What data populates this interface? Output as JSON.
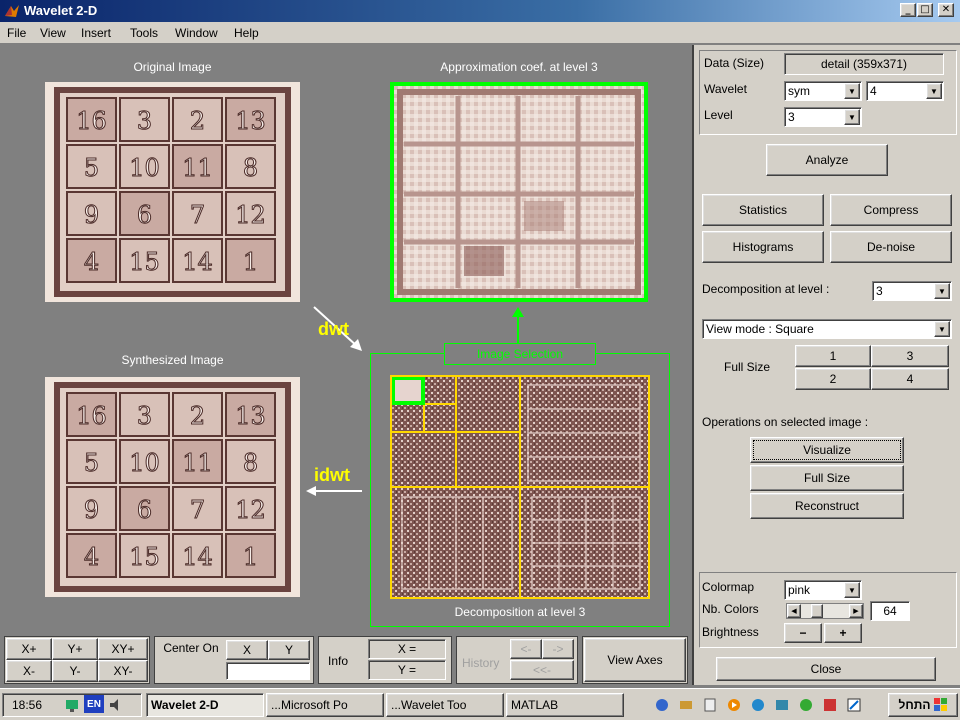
{
  "window": {
    "title": "Wavelet 2-D",
    "min": "_",
    "max": "□",
    "close": "✕"
  },
  "menu": [
    "File",
    "View",
    "Insert",
    "Tools",
    "Window",
    "Help"
  ],
  "images": {
    "original_title": "Original Image",
    "approx_title": "Approximation coef. at level 3",
    "synth_title": "Synthesized Image",
    "decomp_title": "Decomposition at level 3",
    "selection_label": "Image Selection",
    "dwt_label": "dwt",
    "idwt_label": "idwt",
    "magic_square": [
      [
        "16",
        "3",
        "2",
        "13"
      ],
      [
        "5",
        "10",
        "11",
        "8"
      ],
      [
        "9",
        "6",
        "7",
        "12"
      ],
      [
        "4",
        "15",
        "14",
        "1"
      ]
    ]
  },
  "panel": {
    "data_label": "Data (Size)",
    "data_value": "detail (359x371)",
    "wavelet_label": "Wavelet",
    "wavelet_family": "sym",
    "wavelet_order": "4",
    "level_label": "Level",
    "level_value": "3",
    "analyze": "Analyze",
    "statistics": "Statistics",
    "compress": "Compress",
    "histograms": "Histograms",
    "denoise": "De-noise",
    "decomp_level_label": "Decomposition at level :",
    "decomp_level_value": "3",
    "view_mode": "View mode : Square",
    "full_size_label": "Full Size",
    "fs1": "1",
    "fs2": "2",
    "fs3": "3",
    "fs4": "4",
    "ops_label": "Operations on selected image :",
    "visualize": "Visualize",
    "full_size_btn": "Full Size",
    "reconstruct": "Reconstruct",
    "colormap_label": "Colormap",
    "colormap_value": "pink",
    "nb_colors_label": "Nb. Colors",
    "nb_colors_value": "64",
    "nb_colors_fraction": 0.25,
    "brightness_label": "Brightness",
    "minus": "−",
    "plus": "+",
    "close": "Close"
  },
  "bottom": {
    "xplus": "X+",
    "yplus": "Y+",
    "xyplus": "XY+",
    "xminus": "X-",
    "yminus": "Y-",
    "xyminus": "XY-",
    "center_on": "Center On",
    "x": "X",
    "y": "Y",
    "info": "Info",
    "x_eq": "X =",
    "y_eq": "Y =",
    "history": "History",
    "back": "<-",
    "fwd": "->",
    "backback": "<<-",
    "view_axes": "View Axes"
  },
  "taskbar": {
    "time": "18:56",
    "lang": "EN",
    "tasks": [
      "Wavelet 2-D",
      "...Microsoft Po",
      "...Wavelet Too",
      "MATLAB"
    ],
    "start": "התחל"
  },
  "colors": {
    "title_start": "#0a246a",
    "title_end": "#a6caf0",
    "accent_green": "#00ff00",
    "accent_yellow": "#ffff00",
    "face": "#d4d0c8",
    "canvas": "#808080"
  }
}
